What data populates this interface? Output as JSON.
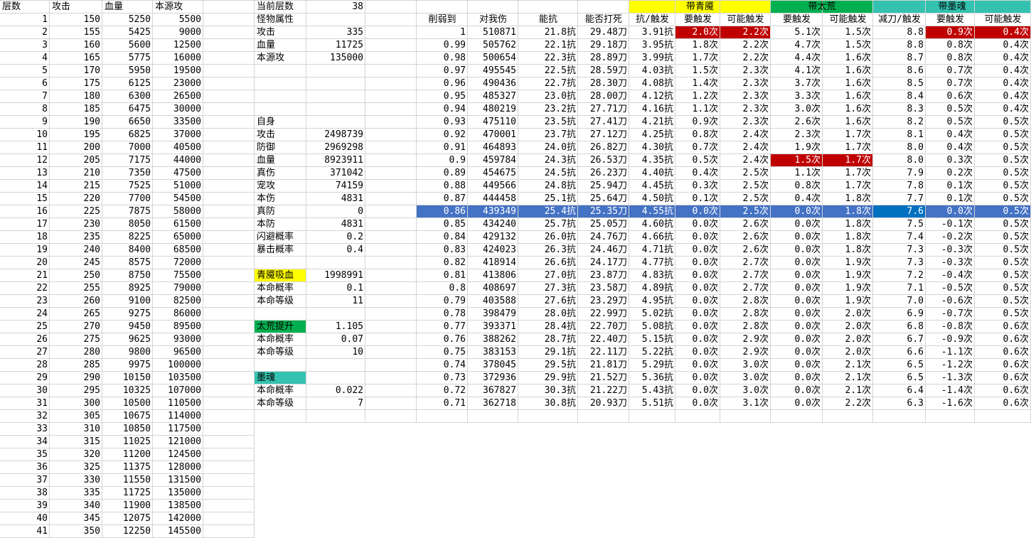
{
  "colors": {
    "yellow": "#ffff00",
    "green": "#00b050",
    "teal": "#33c2b0",
    "red": "#c00000",
    "highlight_row": "#4472c4",
    "highlight_cell": "#0070c0"
  },
  "left_table": {
    "headers": [
      "层数",
      "攻击",
      "血量",
      "本源攻"
    ],
    "rows": [
      [
        "1",
        "150",
        "5250",
        "5500"
      ],
      [
        "2",
        "155",
        "5425",
        "9000"
      ],
      [
        "3",
        "160",
        "5600",
        "12500"
      ],
      [
        "4",
        "165",
        "5775",
        "16000"
      ],
      [
        "5",
        "170",
        "5950",
        "19500"
      ],
      [
        "6",
        "175",
        "6125",
        "23000"
      ],
      [
        "7",
        "180",
        "6300",
        "26500"
      ],
      [
        "8",
        "185",
        "6475",
        "30000"
      ],
      [
        "9",
        "190",
        "6650",
        "33500"
      ],
      [
        "10",
        "195",
        "6825",
        "37000"
      ],
      [
        "11",
        "200",
        "7000",
        "40500"
      ],
      [
        "12",
        "205",
        "7175",
        "44000"
      ],
      [
        "13",
        "210",
        "7350",
        "47500"
      ],
      [
        "14",
        "215",
        "7525",
        "51000"
      ],
      [
        "15",
        "220",
        "7700",
        "54500"
      ],
      [
        "16",
        "225",
        "7875",
        "58000"
      ],
      [
        "17",
        "230",
        "8050",
        "61500"
      ],
      [
        "18",
        "235",
        "8225",
        "65000"
      ],
      [
        "19",
        "240",
        "8400",
        "68500"
      ],
      [
        "20",
        "245",
        "8575",
        "72000"
      ],
      [
        "21",
        "250",
        "8750",
        "75500"
      ],
      [
        "22",
        "255",
        "8925",
        "79000"
      ],
      [
        "23",
        "260",
        "9100",
        "82500"
      ],
      [
        "24",
        "265",
        "9275",
        "86000"
      ],
      [
        "25",
        "270",
        "9450",
        "89500"
      ],
      [
        "26",
        "275",
        "9625",
        "93000"
      ],
      [
        "27",
        "280",
        "9800",
        "96500"
      ],
      [
        "28",
        "285",
        "9975",
        "100000"
      ],
      [
        "29",
        "290",
        "10150",
        "103500"
      ],
      [
        "30",
        "295",
        "10325",
        "107000"
      ],
      [
        "31",
        "300",
        "10500",
        "110500"
      ],
      [
        "32",
        "305",
        "10675",
        "114000"
      ],
      [
        "33",
        "310",
        "10850",
        "117500"
      ],
      [
        "34",
        "315",
        "11025",
        "121000"
      ],
      [
        "35",
        "320",
        "11200",
        "124500"
      ],
      [
        "36",
        "325",
        "11375",
        "128000"
      ],
      [
        "37",
        "330",
        "11550",
        "131500"
      ],
      [
        "38",
        "335",
        "11725",
        "135000"
      ],
      [
        "39",
        "340",
        "11900",
        "138500"
      ],
      [
        "40",
        "345",
        "12075",
        "142000"
      ],
      [
        "41",
        "350",
        "12250",
        "145500"
      ]
    ]
  },
  "params": [
    {
      "row": 0,
      "label": "当前层数",
      "value": "38"
    },
    {
      "row": 1,
      "label": "怪物属性",
      "value": ""
    },
    {
      "row": 2,
      "label": "攻击",
      "value": "335"
    },
    {
      "row": 3,
      "label": "血量",
      "value": "11725"
    },
    {
      "row": 4,
      "label": "本源攻",
      "value": "135000"
    },
    {
      "row": 9,
      "label": "自身",
      "value": ""
    },
    {
      "row": 10,
      "label": "攻击",
      "value": "2498739"
    },
    {
      "row": 11,
      "label": "防御",
      "value": "2969298"
    },
    {
      "row": 12,
      "label": "血量",
      "value": "8923911"
    },
    {
      "row": 13,
      "label": "真伤",
      "value": "371042"
    },
    {
      "row": 14,
      "label": "宠攻",
      "value": "74159"
    },
    {
      "row": 15,
      "label": "本伤",
      "value": "4831"
    },
    {
      "row": 16,
      "label": "真防",
      "value": "0"
    },
    {
      "row": 17,
      "label": "本防",
      "value": "4831"
    },
    {
      "row": 18,
      "label": "闪避概率",
      "value": "0.2"
    },
    {
      "row": 19,
      "label": "暴击概率",
      "value": "0.4"
    },
    {
      "row": 21,
      "label": "青魇吸血",
      "value": "1998991",
      "fill": "yellow"
    },
    {
      "row": 22,
      "label": "本命概率",
      "value": "0.1"
    },
    {
      "row": 23,
      "label": "本命等级",
      "value": "11"
    },
    {
      "row": 25,
      "label": "太荒提升",
      "value": "1.105",
      "fill": "green"
    },
    {
      "row": 26,
      "label": "本命概率",
      "value": "0.07"
    },
    {
      "row": 27,
      "label": "本命等级",
      "value": "10"
    },
    {
      "row": 29,
      "label": "墨魂",
      "value": "",
      "fill": "teal"
    },
    {
      "row": 30,
      "label": "本命概率",
      "value": "0.022"
    },
    {
      "row": 31,
      "label": "本命等级",
      "value": "7"
    }
  ],
  "group_headers": [
    {
      "label": "带青魇",
      "fill": "yellow"
    },
    {
      "label": "带太荒",
      "fill": "green"
    },
    {
      "label": "带墨魂",
      "fill": "teal"
    }
  ],
  "right_table": {
    "headers": [
      "削弱到",
      "对我伤",
      "能抗",
      "能否打死",
      "抗/触发",
      "要触发",
      "可能触发",
      "要触发",
      "可能触发",
      "减刀/触发",
      "要触发",
      "可能触发"
    ],
    "rows": [
      [
        "1",
        "510871",
        "21.8抗",
        "29.48刀",
        "3.91抗",
        "2.0次",
        "2.2次",
        "5.1次",
        "1.5次",
        "8.8",
        "0.9次",
        "0.4次"
      ],
      [
        "0.99",
        "505762",
        "22.1抗",
        "29.18刀",
        "3.95抗",
        "1.8次",
        "2.2次",
        "4.7次",
        "1.5次",
        "8.8",
        "0.8次",
        "0.4次"
      ],
      [
        "0.98",
        "500654",
        "22.3抗",
        "28.89刀",
        "3.99抗",
        "1.7次",
        "2.2次",
        "4.4次",
        "1.6次",
        "8.7",
        "0.8次",
        "0.4次"
      ],
      [
        "0.97",
        "495545",
        "22.5抗",
        "28.59刀",
        "4.03抗",
        "1.5次",
        "2.3次",
        "4.1次",
        "1.6次",
        "8.6",
        "0.7次",
        "0.4次"
      ],
      [
        "0.96",
        "490436",
        "22.7抗",
        "28.30刀",
        "4.08抗",
        "1.4次",
        "2.3次",
        "3.7次",
        "1.6次",
        "8.5",
        "0.7次",
        "0.4次"
      ],
      [
        "0.95",
        "485327",
        "23.0抗",
        "28.00刀",
        "4.12抗",
        "1.2次",
        "2.3次",
        "3.3次",
        "1.6次",
        "8.4",
        "0.6次",
        "0.4次"
      ],
      [
        "0.94",
        "480219",
        "23.2抗",
        "27.71刀",
        "4.16抗",
        "1.1次",
        "2.3次",
        "3.0次",
        "1.6次",
        "8.3",
        "0.5次",
        "0.4次"
      ],
      [
        "0.93",
        "475110",
        "23.5抗",
        "27.41刀",
        "4.21抗",
        "0.9次",
        "2.3次",
        "2.6次",
        "1.6次",
        "8.2",
        "0.5次",
        "0.5次"
      ],
      [
        "0.92",
        "470001",
        "23.7抗",
        "27.12刀",
        "4.25抗",
        "0.8次",
        "2.4次",
        "2.3次",
        "1.7次",
        "8.1",
        "0.4次",
        "0.5次"
      ],
      [
        "0.91",
        "464893",
        "24.0抗",
        "26.82刀",
        "4.30抗",
        "0.7次",
        "2.4次",
        "1.9次",
        "1.7次",
        "8.0",
        "0.4次",
        "0.5次"
      ],
      [
        "0.9",
        "459784",
        "24.3抗",
        "26.53刀",
        "4.35抗",
        "0.5次",
        "2.4次",
        "1.5次",
        "1.7次",
        "8.0",
        "0.3次",
        "0.5次"
      ],
      [
        "0.89",
        "454675",
        "24.5抗",
        "26.23刀",
        "4.40抗",
        "0.4次",
        "2.5次",
        "1.1次",
        "1.7次",
        "7.9",
        "0.2次",
        "0.5次"
      ],
      [
        "0.88",
        "449566",
        "24.8抗",
        "25.94刀",
        "4.45抗",
        "0.3次",
        "2.5次",
        "0.8次",
        "1.7次",
        "7.8",
        "0.1次",
        "0.5次"
      ],
      [
        "0.87",
        "444458",
        "25.1抗",
        "25.64刀",
        "4.50抗",
        "0.1次",
        "2.5次",
        "0.4次",
        "1.8次",
        "7.7",
        "0.1次",
        "0.5次"
      ],
      [
        "0.86",
        "439349",
        "25.4抗",
        "25.35刀",
        "4.55抗",
        "0.0次",
        "2.5次",
        "0.0次",
        "1.8次",
        "7.6",
        "0.0次",
        "0.5次"
      ],
      [
        "0.85",
        "434240",
        "25.7抗",
        "25.05刀",
        "4.60抗",
        "0.0次",
        "2.6次",
        "0.0次",
        "1.8次",
        "7.5",
        "-0.1次",
        "0.5次"
      ],
      [
        "0.84",
        "429132",
        "26.0抗",
        "24.76刀",
        "4.66抗",
        "0.0次",
        "2.6次",
        "0.0次",
        "1.8次",
        "7.4",
        "-0.2次",
        "0.5次"
      ],
      [
        "0.83",
        "424023",
        "26.3抗",
        "24.46刀",
        "4.71抗",
        "0.0次",
        "2.6次",
        "0.0次",
        "1.8次",
        "7.3",
        "-0.3次",
        "0.5次"
      ],
      [
        "0.82",
        "418914",
        "26.6抗",
        "24.17刀",
        "4.77抗",
        "0.0次",
        "2.7次",
        "0.0次",
        "1.9次",
        "7.3",
        "-0.3次",
        "0.5次"
      ],
      [
        "0.81",
        "413806",
        "27.0抗",
        "23.87刀",
        "4.83抗",
        "0.0次",
        "2.7次",
        "0.0次",
        "1.9次",
        "7.2",
        "-0.4次",
        "0.5次"
      ],
      [
        "0.8",
        "408697",
        "27.3抗",
        "23.58刀",
        "4.89抗",
        "0.0次",
        "2.7次",
        "0.0次",
        "1.9次",
        "7.1",
        "-0.5次",
        "0.5次"
      ],
      [
        "0.79",
        "403588",
        "27.6抗",
        "23.29刀",
        "4.95抗",
        "0.0次",
        "2.8次",
        "0.0次",
        "1.9次",
        "7.0",
        "-0.6次",
        "0.5次"
      ],
      [
        "0.78",
        "398479",
        "28.0抗",
        "22.99刀",
        "5.02抗",
        "0.0次",
        "2.8次",
        "0.0次",
        "2.0次",
        "6.9",
        "-0.7次",
        "0.5次"
      ],
      [
        "0.77",
        "393371",
        "28.4抗",
        "22.70刀",
        "5.08抗",
        "0.0次",
        "2.8次",
        "0.0次",
        "2.0次",
        "6.8",
        "-0.8次",
        "0.6次"
      ],
      [
        "0.76",
        "388262",
        "28.7抗",
        "22.40刀",
        "5.15抗",
        "0.0次",
        "2.9次",
        "0.0次",
        "2.0次",
        "6.7",
        "-0.9次",
        "0.6次"
      ],
      [
        "0.75",
        "383153",
        "29.1抗",
        "22.11刀",
        "5.22抗",
        "0.0次",
        "2.9次",
        "0.0次",
        "2.0次",
        "6.6",
        "-1.1次",
        "0.6次"
      ],
      [
        "0.74",
        "378045",
        "29.5抗",
        "21.81刀",
        "5.29抗",
        "0.0次",
        "3.0次",
        "0.0次",
        "2.1次",
        "6.5",
        "-1.2次",
        "0.6次"
      ],
      [
        "0.73",
        "372936",
        "29.9抗",
        "21.52刀",
        "5.36抗",
        "0.0次",
        "3.0次",
        "0.0次",
        "2.1次",
        "6.5",
        "-1.3次",
        "0.6次"
      ],
      [
        "0.72",
        "367827",
        "30.3抗",
        "21.22刀",
        "5.43抗",
        "0.0次",
        "3.0次",
        "0.0次",
        "2.1次",
        "6.4",
        "-1.4次",
        "0.6次"
      ],
      [
        "0.71",
        "362718",
        "30.8抗",
        "20.93刀",
        "5.51抗",
        "0.0次",
        "3.1次",
        "0.0次",
        "2.2次",
        "6.3",
        "-1.6次",
        "0.6次"
      ]
    ],
    "red_cells": [
      [
        0,
        5
      ],
      [
        0,
        6
      ],
      [
        0,
        10
      ],
      [
        0,
        11
      ],
      [
        10,
        7
      ],
      [
        10,
        8
      ]
    ],
    "highlight_row_index": 14,
    "highlight_cell_column": 9
  }
}
